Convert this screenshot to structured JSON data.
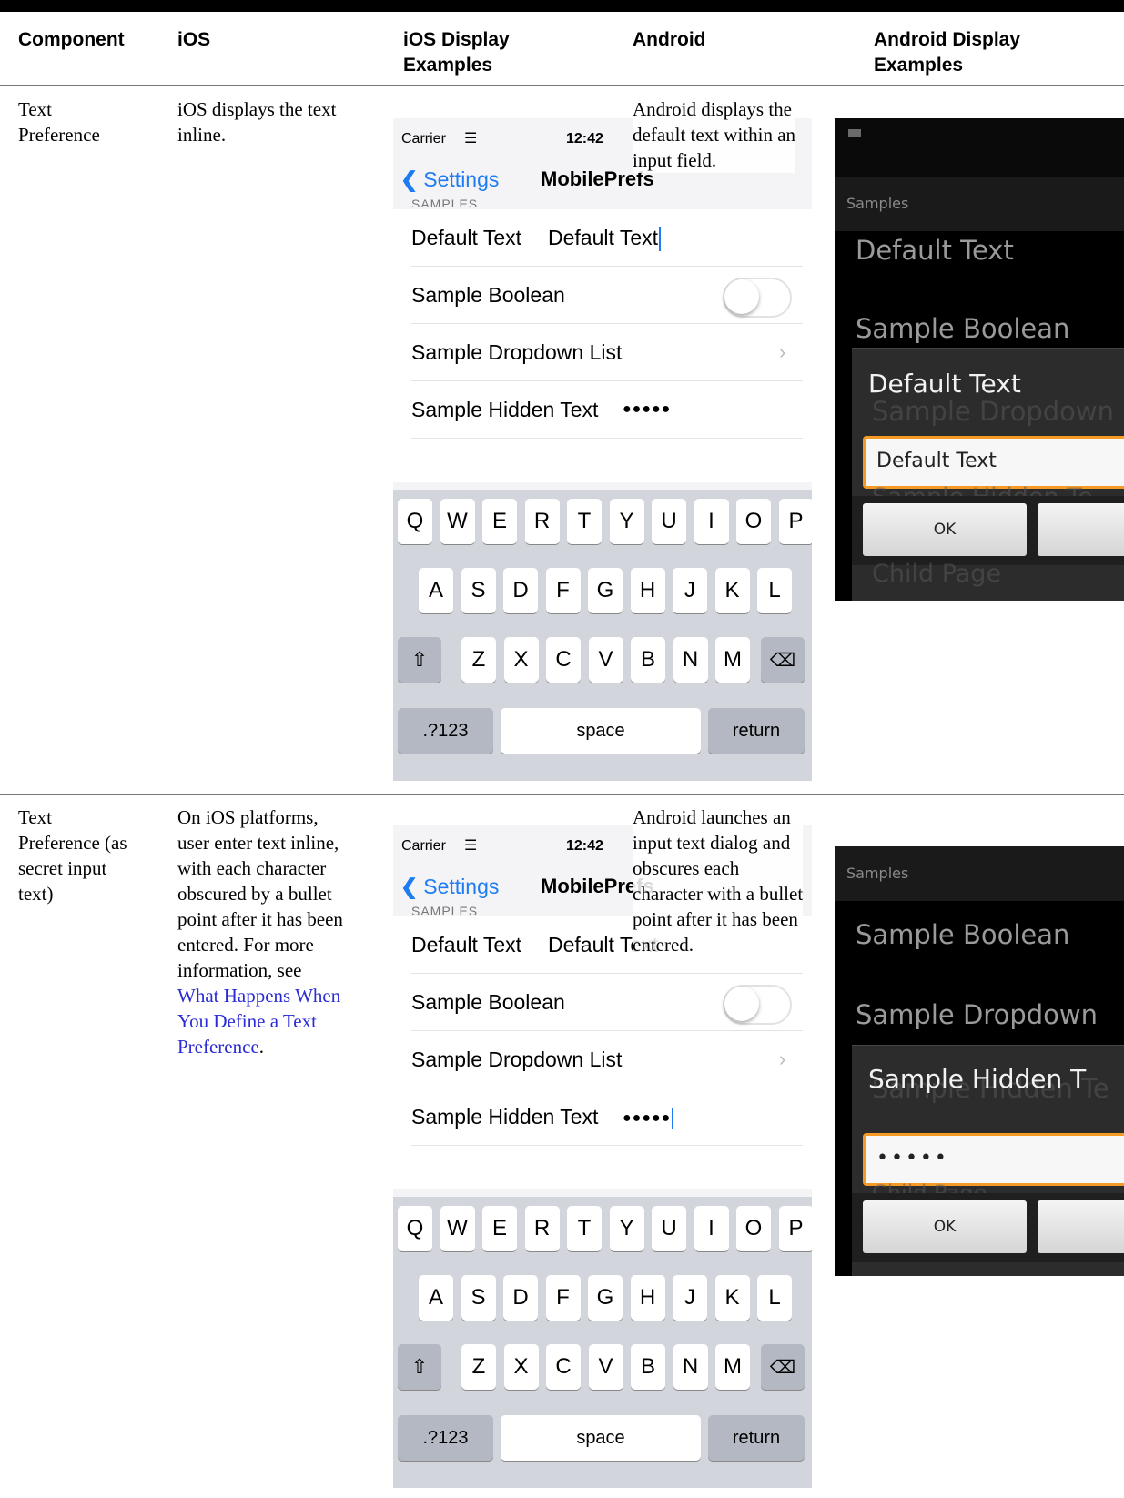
{
  "headers": {
    "component": "Component",
    "ios": "iOS",
    "ios_display": "iOS Display\nExamples",
    "android": "Android",
    "android_display": "Android Display\nExamples"
  },
  "rows": [
    {
      "component": "Text\nPreference",
      "ios_text": "iOS displays the text\ninline.",
      "android_text": "Android displays the\ndefault text within an\ninput field."
    },
    {
      "component": "Text\nPreference (as\nsecret input\ntext)",
      "ios_text_pre": "On iOS platforms,\nuser enter text inline,\nwith each character\nobscured by a bullet\npoint after it has been\nentered. For more\ninformation, see\n",
      "ios_link": "What Happens When\nYou Define a Text\nPreference",
      "ios_text_post": ".",
      "android_text": "Android launches an\ninput text dialog and\nobscures each\ncharacter with a bullet\npoint after it has been\nentered."
    }
  ],
  "ios_screen": {
    "carrier": "Carrier",
    "time": "12:42",
    "back_label": "Settings",
    "title": "MobilePrefs",
    "section": "SAMPLES",
    "rows": {
      "default_text_label": "Default Text",
      "default_text_value": "Default Text",
      "boolean_label": "Sample Boolean",
      "dropdown_label": "Sample Dropdown List",
      "hidden_label": "Sample Hidden Text",
      "hidden_value": "●●●●●"
    },
    "keyboard": {
      "row1": [
        "Q",
        "W",
        "E",
        "R",
        "T",
        "Y",
        "U",
        "I",
        "O",
        "P"
      ],
      "row2": [
        "A",
        "S",
        "D",
        "F",
        "G",
        "H",
        "J",
        "K",
        "L"
      ],
      "row3": [
        "Z",
        "X",
        "C",
        "V",
        "B",
        "N",
        "M"
      ],
      "numbers": ".?123",
      "space": "space",
      "return": "return"
    }
  },
  "android_1": {
    "section": "Samples",
    "pref1": "Default Text",
    "pref2": "Sample Boolean",
    "dialog_title": "Default Text",
    "underlay1": "Sample Dropdown",
    "field_value": "Default Text",
    "underlay2": "Sample Hidden Te",
    "ok": "OK",
    "underlay3": "Child Page"
  },
  "android_2": {
    "section": "Samples",
    "pref1": "Sample Boolean",
    "pref2": "Sample Dropdown",
    "dialog_title": "Sample Hidden T",
    "underlay1": "Sample Hidden Te",
    "field_value": "•••••",
    "underlay2": "Child Page",
    "ok": "OK"
  }
}
